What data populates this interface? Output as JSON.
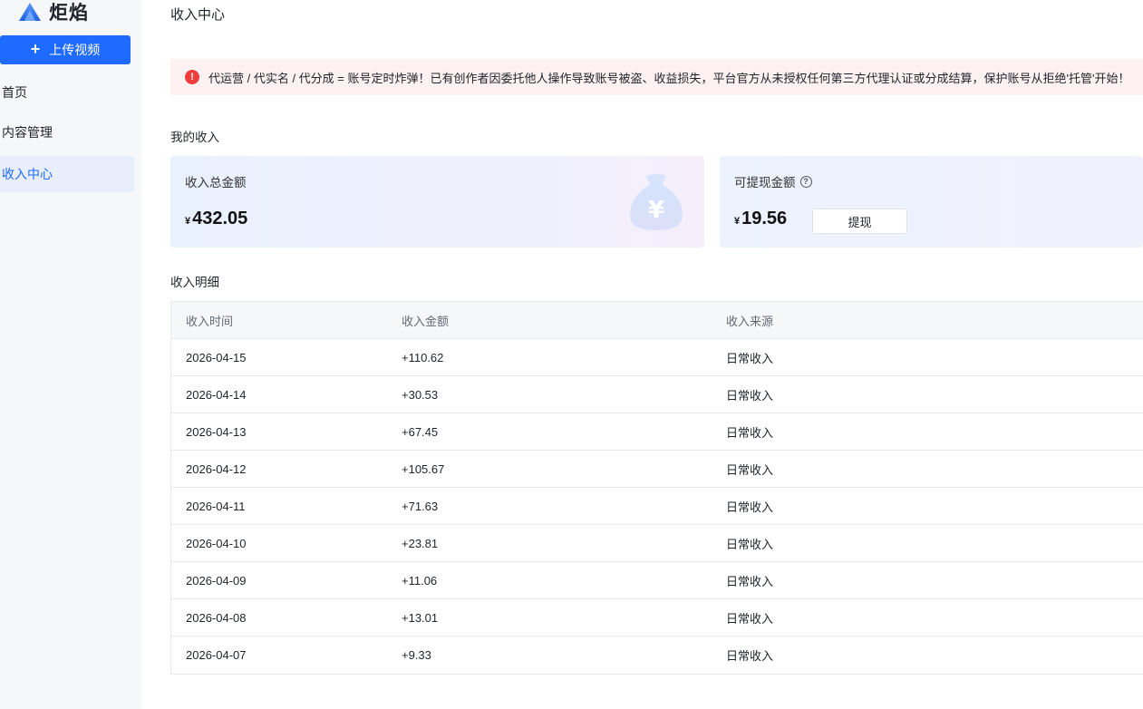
{
  "brand": {
    "name": "炬焰"
  },
  "sidebar": {
    "upload_label": "上传视频",
    "items": [
      {
        "label": "首页"
      },
      {
        "label": "内容管理"
      },
      {
        "label": "收入中心"
      }
    ],
    "active_index": 2
  },
  "header": {
    "title": "收入中心"
  },
  "alert": {
    "text": "代运营 / 代实名 / 代分成 = 账号定时炸弹！已有创作者因委托他人操作导致账号被盗、收益损失，平台官方从未授权任何第三方代理认证或分成结算，保护账号从拒绝'托管'开始！"
  },
  "income": {
    "section_title": "我的收入",
    "total_label": "收入总金额",
    "currency": "¥",
    "total_amount": "432.05",
    "withdrawable_label": "可提现金额",
    "withdrawable_amount": "19.56",
    "withdraw_button": "提现"
  },
  "details": {
    "section_title": "收入明细",
    "columns": [
      "收入时间",
      "收入金额",
      "收入来源"
    ],
    "rows": [
      [
        "2026-04-15",
        "+110.62",
        "日常收入"
      ],
      [
        "2026-04-14",
        "+30.53",
        "日常收入"
      ],
      [
        "2026-04-13",
        "+67.45",
        "日常收入"
      ],
      [
        "2026-04-12",
        "+105.67",
        "日常收入"
      ],
      [
        "2026-04-11",
        "+71.63",
        "日常收入"
      ],
      [
        "2026-04-10",
        "+23.81",
        "日常收入"
      ],
      [
        "2026-04-09",
        "+11.06",
        "日常收入"
      ],
      [
        "2026-04-08",
        "+13.01",
        "日常收入"
      ],
      [
        "2026-04-07",
        "+9.33",
        "日常收入"
      ]
    ]
  },
  "colors": {
    "accent": "#1f6bff",
    "alert_icon": "#f03c3c",
    "alert_bg": "#fdf1f1"
  },
  "icons": {
    "logo": "flame-logo-icon",
    "plus": "plus-icon",
    "alert": "exclamation-icon",
    "help": "question-circle-icon",
    "bag": "money-bag-icon"
  }
}
